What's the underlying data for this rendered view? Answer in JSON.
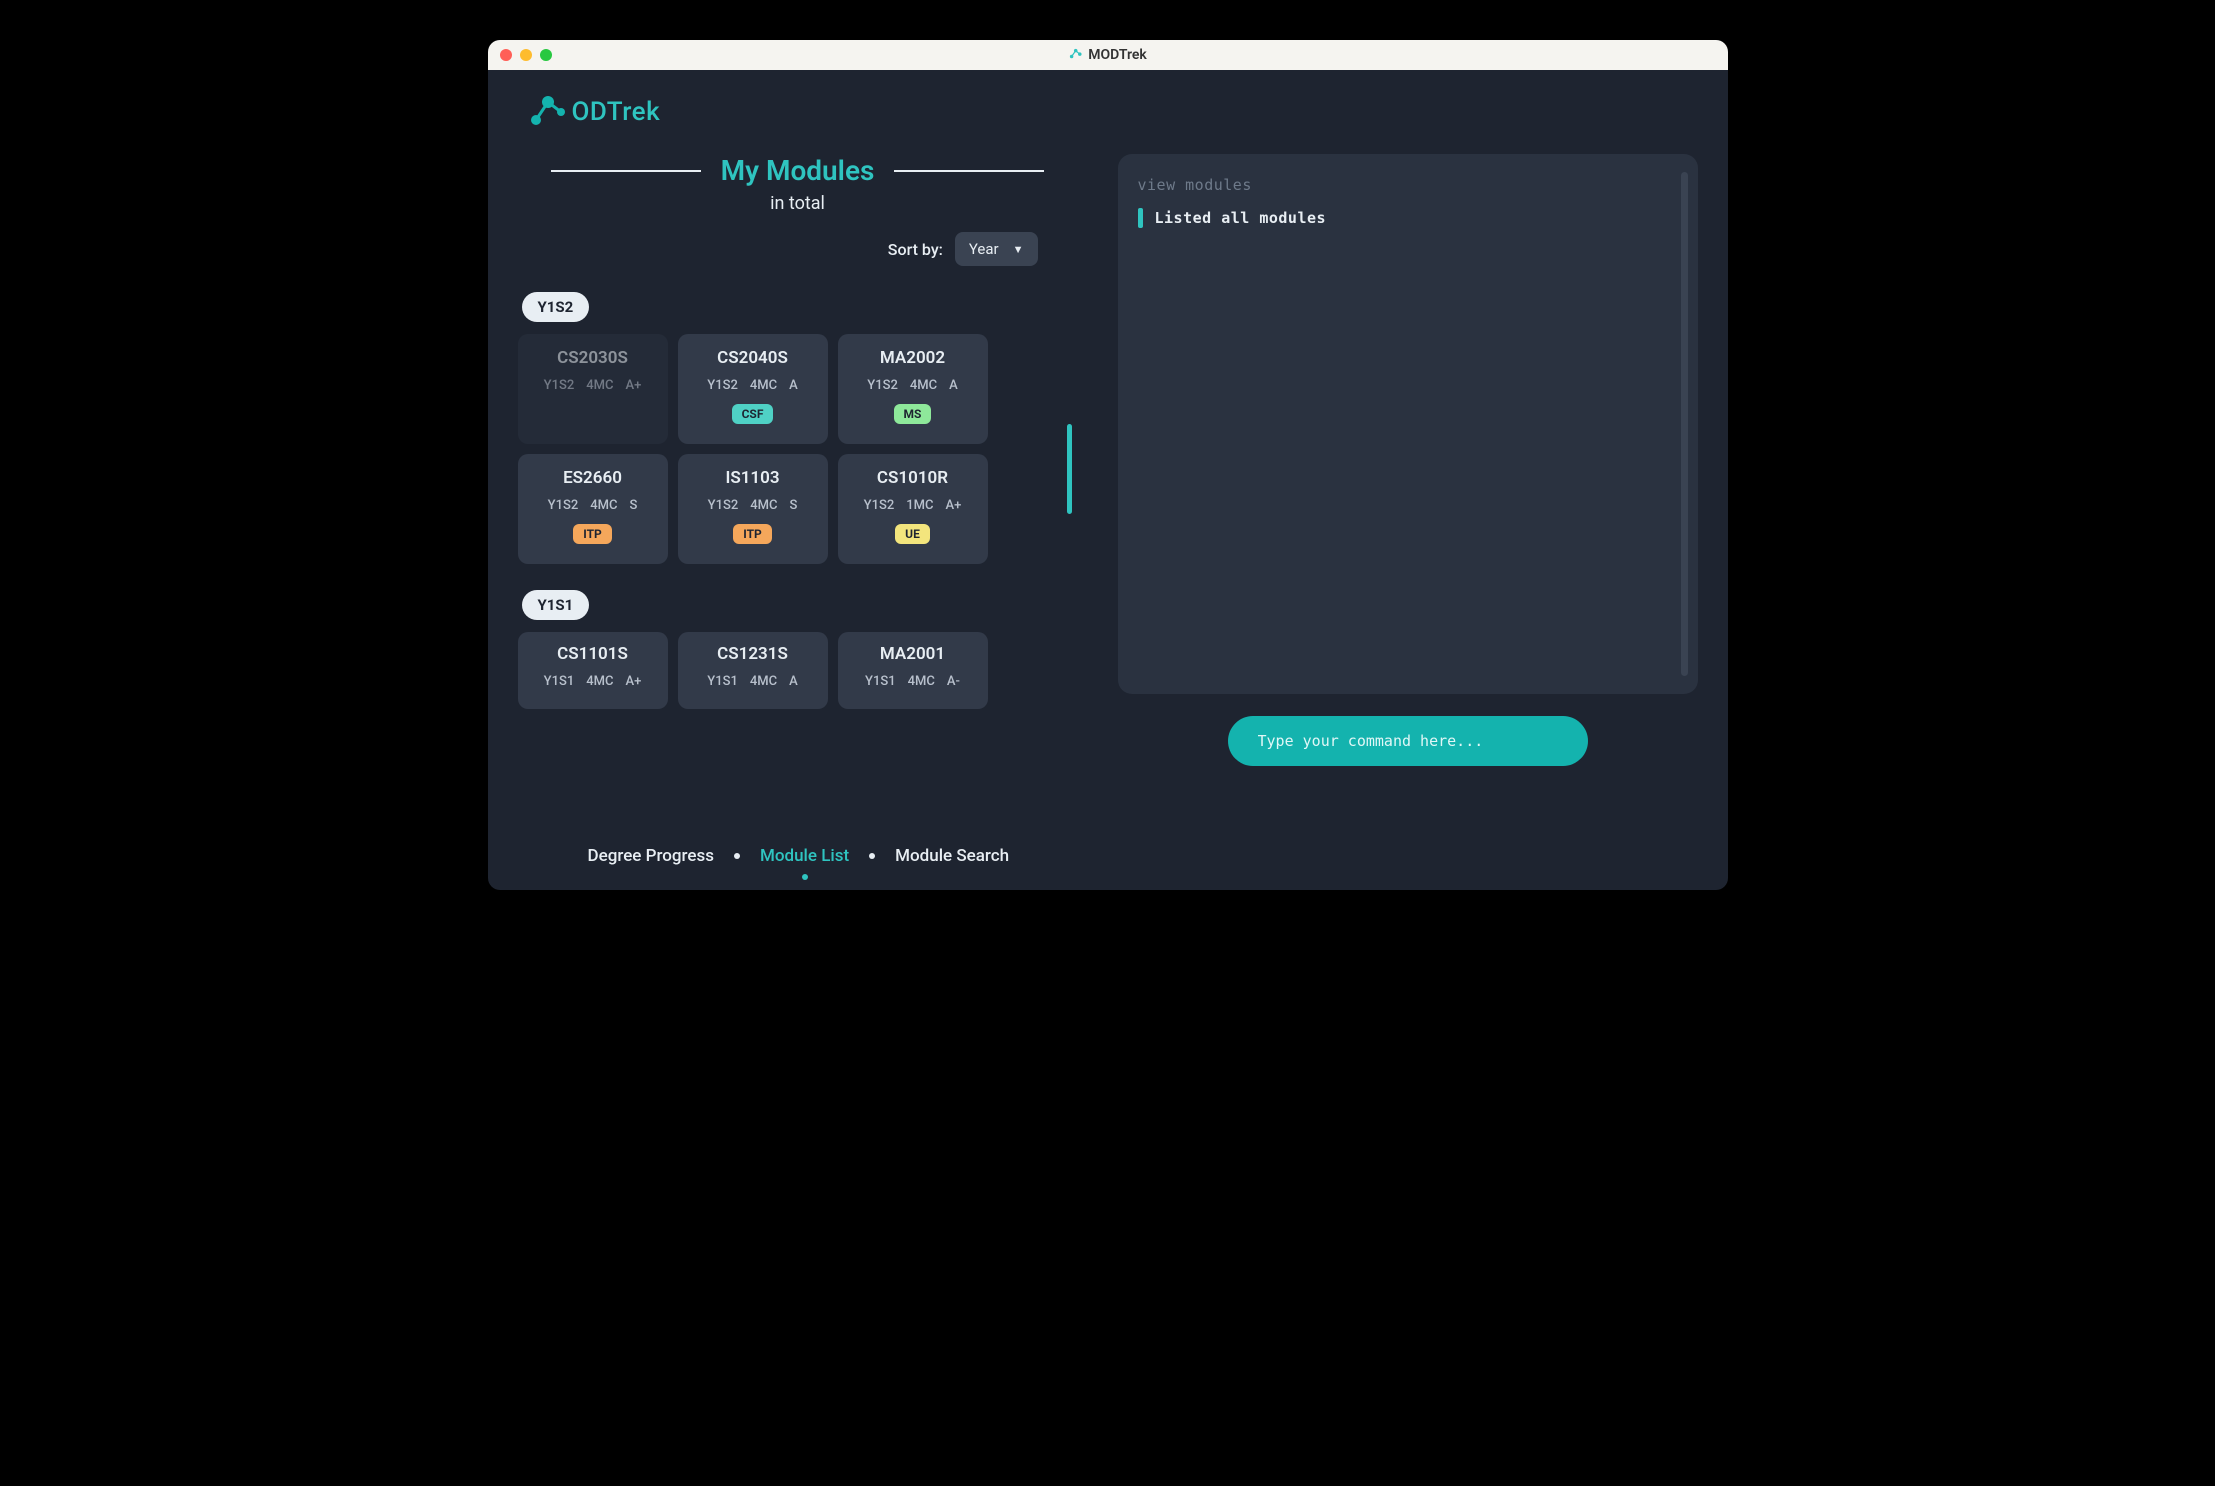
{
  "window": {
    "title": "MODTrek"
  },
  "logo": {
    "text": "ODTrek"
  },
  "header": {
    "title": "My Modules",
    "subtitle": "in total"
  },
  "sort": {
    "label": "Sort by:",
    "selected": "Year"
  },
  "sections": [
    {
      "label": "Y1S2",
      "cards": [
        {
          "code": "CS2030S",
          "sem": "Y1S2",
          "mc": "4MC",
          "grade": "A+",
          "tag": null,
          "dim": true
        },
        {
          "code": "CS2040S",
          "sem": "Y1S2",
          "mc": "4MC",
          "grade": "A",
          "tag": "CSF",
          "dim": false
        },
        {
          "code": "MA2002",
          "sem": "Y1S2",
          "mc": "4MC",
          "grade": "A",
          "tag": "MS",
          "dim": false
        },
        {
          "code": "ES2660",
          "sem": "Y1S2",
          "mc": "4MC",
          "grade": "S",
          "tag": "ITP",
          "dim": false
        },
        {
          "code": "IS1103",
          "sem": "Y1S2",
          "mc": "4MC",
          "grade": "S",
          "tag": "ITP",
          "dim": false
        },
        {
          "code": "CS1010R",
          "sem": "Y1S2",
          "mc": "1MC",
          "grade": "A+",
          "tag": "UE",
          "dim": false
        }
      ]
    },
    {
      "label": "Y1S1",
      "cards": [
        {
          "code": "CS1101S",
          "sem": "Y1S1",
          "mc": "4MC",
          "grade": "A+",
          "tag": null,
          "dim": false
        },
        {
          "code": "CS1231S",
          "sem": "Y1S1",
          "mc": "4MC",
          "grade": "A",
          "tag": null,
          "dim": false
        },
        {
          "code": "MA2001",
          "sem": "Y1S1",
          "mc": "4MC",
          "grade": "A-",
          "tag": null,
          "dim": false
        }
      ]
    }
  ],
  "console": {
    "command": "view modules",
    "result": "Listed all modules"
  },
  "command_input": {
    "placeholder": "Type your command here..."
  },
  "nav": {
    "items": [
      {
        "label": "Degree Progress",
        "active": false
      },
      {
        "label": "Module List",
        "active": true
      },
      {
        "label": "Module Search",
        "active": false
      }
    ]
  }
}
